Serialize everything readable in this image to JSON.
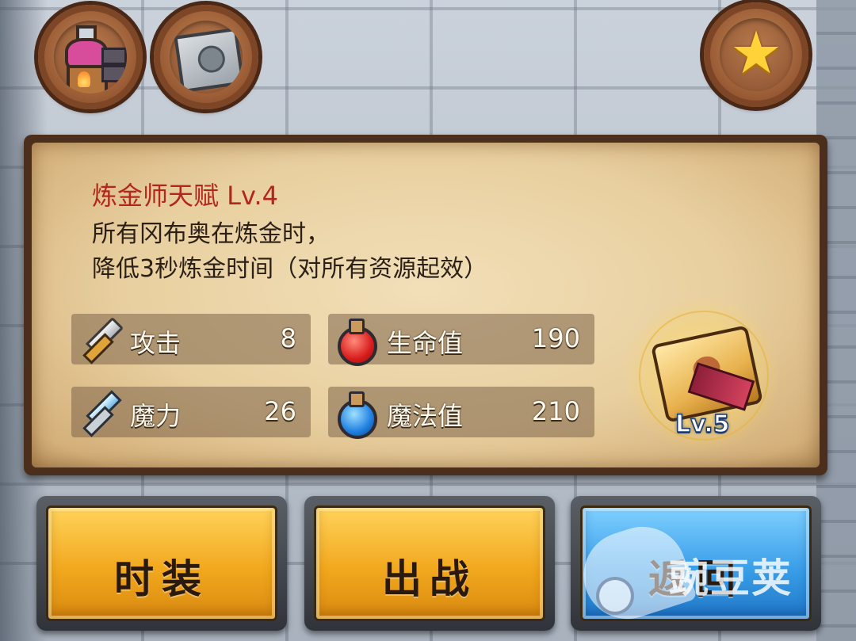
{
  "top_buttons": [
    {
      "icon": "alchemy-furnace-icon"
    },
    {
      "icon": "stone-tablet-icon"
    },
    {
      "icon": "star-icon"
    }
  ],
  "talent": {
    "title": "炼金师天赋 Lv.4",
    "desc_line1": "所有冈布奥在炼金时，",
    "desc_line2": "降低3秒炼金时间（对所有资源起效）"
  },
  "stats": {
    "attack": {
      "label": "攻击",
      "value": "8"
    },
    "hp": {
      "label": "生命值",
      "value": "190"
    },
    "power": {
      "label": "魔力",
      "value": "26"
    },
    "mp": {
      "label": "魔法值",
      "value": "210"
    }
  },
  "emblem": {
    "level": "Lv.5"
  },
  "buttons": {
    "costume": "时装",
    "battle": "出战",
    "return": "返回"
  },
  "watermark": {
    "text": "豌豆荚"
  },
  "colors": {
    "title_red": "#b3261e",
    "gold_button": "#f2a81e",
    "blue_button": "#3a9ee8"
  }
}
